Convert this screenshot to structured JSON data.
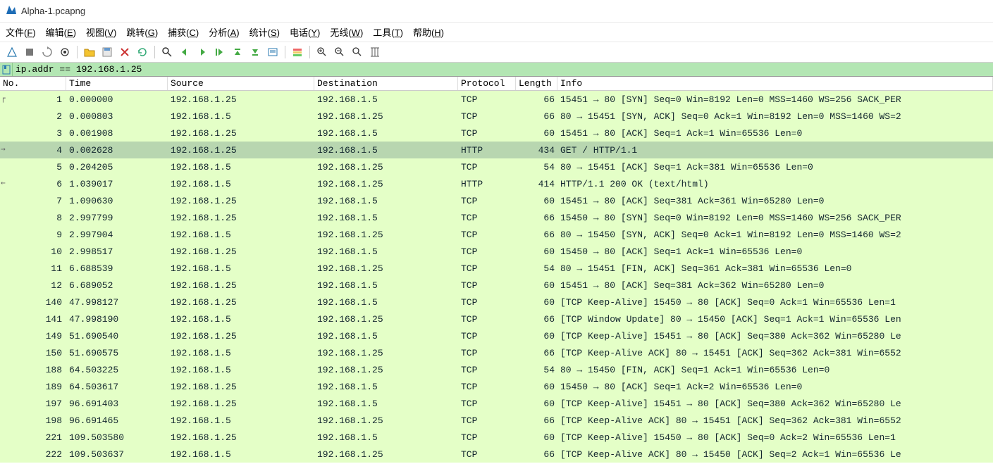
{
  "window": {
    "title": "Alpha-1.pcapng"
  },
  "menu": {
    "file": "文件(F)",
    "edit": "编辑(E)",
    "view": "视图(V)",
    "go": "跳转(G)",
    "capture": "捕获(C)",
    "analyze": "分析(A)",
    "stats": "统计(S)",
    "telephony": "电话(Y)",
    "wireless": "无线(W)",
    "tools": "工具(T)",
    "help": "帮助(H)"
  },
  "filter": {
    "value": "ip.addr == 192.168.1.25"
  },
  "columns": {
    "no": "No.",
    "time": "Time",
    "src": "Source",
    "dst": "Destination",
    "proto": "Protocol",
    "len": "Length",
    "info": "Info"
  },
  "packets": [
    {
      "no": "1",
      "time": "0.000000",
      "src": "192.168.1.25",
      "dst": "192.168.1.5",
      "proto": "TCP",
      "len": "66",
      "info": "15451 → 80 [SYN] Seq=0 Win=8192 Len=0 MSS=1460 WS=256 SACK_PER",
      "sel": false,
      "first": true
    },
    {
      "no": "2",
      "time": "0.000803",
      "src": "192.168.1.5",
      "dst": "192.168.1.25",
      "proto": "TCP",
      "len": "66",
      "info": "80 → 15451 [SYN, ACK] Seq=0 Ack=1 Win=8192 Len=0 MSS=1460 WS=2",
      "sel": false
    },
    {
      "no": "3",
      "time": "0.001908",
      "src": "192.168.1.25",
      "dst": "192.168.1.5",
      "proto": "TCP",
      "len": "60",
      "info": "15451 → 80 [ACK] Seq=1 Ack=1 Win=65536 Len=0",
      "sel": false
    },
    {
      "no": "4",
      "time": "0.002628",
      "src": "192.168.1.25",
      "dst": "192.168.1.5",
      "proto": "HTTP",
      "len": "434",
      "info": "GET / HTTP/1.1 ",
      "sel": true,
      "arrow": true
    },
    {
      "no": "5",
      "time": "0.204205",
      "src": "192.168.1.5",
      "dst": "192.168.1.25",
      "proto": "TCP",
      "len": "54",
      "info": "80 → 15451 [ACK] Seq=1 Ack=381 Win=65536 Len=0",
      "sel": false
    },
    {
      "no": "6",
      "time": "1.039017",
      "src": "192.168.1.5",
      "dst": "192.168.1.25",
      "proto": "HTTP",
      "len": "414",
      "info": "HTTP/1.1 200 OK  (text/html)",
      "sel": false,
      "back": true
    },
    {
      "no": "7",
      "time": "1.090630",
      "src": "192.168.1.25",
      "dst": "192.168.1.5",
      "proto": "TCP",
      "len": "60",
      "info": "15451 → 80 [ACK] Seq=381 Ack=361 Win=65280 Len=0",
      "sel": false
    },
    {
      "no": "8",
      "time": "2.997799",
      "src": "192.168.1.25",
      "dst": "192.168.1.5",
      "proto": "TCP",
      "len": "66",
      "info": "15450 → 80 [SYN] Seq=0 Win=8192 Len=0 MSS=1460 WS=256 SACK_PER",
      "sel": false
    },
    {
      "no": "9",
      "time": "2.997904",
      "src": "192.168.1.5",
      "dst": "192.168.1.25",
      "proto": "TCP",
      "len": "66",
      "info": "80 → 15450 [SYN, ACK] Seq=0 Ack=1 Win=8192 Len=0 MSS=1460 WS=2",
      "sel": false
    },
    {
      "no": "10",
      "time": "2.998517",
      "src": "192.168.1.25",
      "dst": "192.168.1.5",
      "proto": "TCP",
      "len": "60",
      "info": "15450 → 80 [ACK] Seq=1 Ack=1 Win=65536 Len=0",
      "sel": false
    },
    {
      "no": "11",
      "time": "6.688539",
      "src": "192.168.1.5",
      "dst": "192.168.1.25",
      "proto": "TCP",
      "len": "54",
      "info": "80 → 15451 [FIN, ACK] Seq=361 Ack=381 Win=65536 Len=0",
      "sel": false
    },
    {
      "no": "12",
      "time": "6.689052",
      "src": "192.168.1.25",
      "dst": "192.168.1.5",
      "proto": "TCP",
      "len": "60",
      "info": "15451 → 80 [ACK] Seq=381 Ack=362 Win=65280 Len=0",
      "sel": false
    },
    {
      "no": "140",
      "time": "47.998127",
      "src": "192.168.1.25",
      "dst": "192.168.1.5",
      "proto": "TCP",
      "len": "60",
      "info": "[TCP Keep-Alive] 15450 → 80 [ACK] Seq=0 Ack=1 Win=65536 Len=1",
      "sel": false
    },
    {
      "no": "141",
      "time": "47.998190",
      "src": "192.168.1.5",
      "dst": "192.168.1.25",
      "proto": "TCP",
      "len": "66",
      "info": "[TCP Window Update] 80 → 15450 [ACK] Seq=1 Ack=1 Win=65536 Len",
      "sel": false
    },
    {
      "no": "149",
      "time": "51.690540",
      "src": "192.168.1.25",
      "dst": "192.168.1.5",
      "proto": "TCP",
      "len": "60",
      "info": "[TCP Keep-Alive] 15451 → 80 [ACK] Seq=380 Ack=362 Win=65280 Le",
      "sel": false
    },
    {
      "no": "150",
      "time": "51.690575",
      "src": "192.168.1.5",
      "dst": "192.168.1.25",
      "proto": "TCP",
      "len": "66",
      "info": "[TCP Keep-Alive ACK] 80 → 15451 [ACK] Seq=362 Ack=381 Win=6552",
      "sel": false
    },
    {
      "no": "188",
      "time": "64.503225",
      "src": "192.168.1.5",
      "dst": "192.168.1.25",
      "proto": "TCP",
      "len": "54",
      "info": "80 → 15450 [FIN, ACK] Seq=1 Ack=1 Win=65536 Len=0",
      "sel": false
    },
    {
      "no": "189",
      "time": "64.503617",
      "src": "192.168.1.25",
      "dst": "192.168.1.5",
      "proto": "TCP",
      "len": "60",
      "info": "15450 → 80 [ACK] Seq=1 Ack=2 Win=65536 Len=0",
      "sel": false
    },
    {
      "no": "197",
      "time": "96.691403",
      "src": "192.168.1.25",
      "dst": "192.168.1.5",
      "proto": "TCP",
      "len": "60",
      "info": "[TCP Keep-Alive] 15451 → 80 [ACK] Seq=380 Ack=362 Win=65280 Le",
      "sel": false
    },
    {
      "no": "198",
      "time": "96.691465",
      "src": "192.168.1.5",
      "dst": "192.168.1.25",
      "proto": "TCP",
      "len": "66",
      "info": "[TCP Keep-Alive ACK] 80 → 15451 [ACK] Seq=362 Ack=381 Win=6552",
      "sel": false
    },
    {
      "no": "221",
      "time": "109.503580",
      "src": "192.168.1.25",
      "dst": "192.168.1.5",
      "proto": "TCP",
      "len": "60",
      "info": "[TCP Keep-Alive] 15450 → 80 [ACK] Seq=0 Ack=2 Win=65536 Len=1",
      "sel": false
    },
    {
      "no": "222",
      "time": "109.503637",
      "src": "192.168.1.5",
      "dst": "192.168.1.25",
      "proto": "TCP",
      "len": "66",
      "info": "[TCP Keep-Alive ACK] 80 → 15450 [ACK] Seq=2 Ack=1 Win=65536 Le",
      "sel": false
    }
  ]
}
